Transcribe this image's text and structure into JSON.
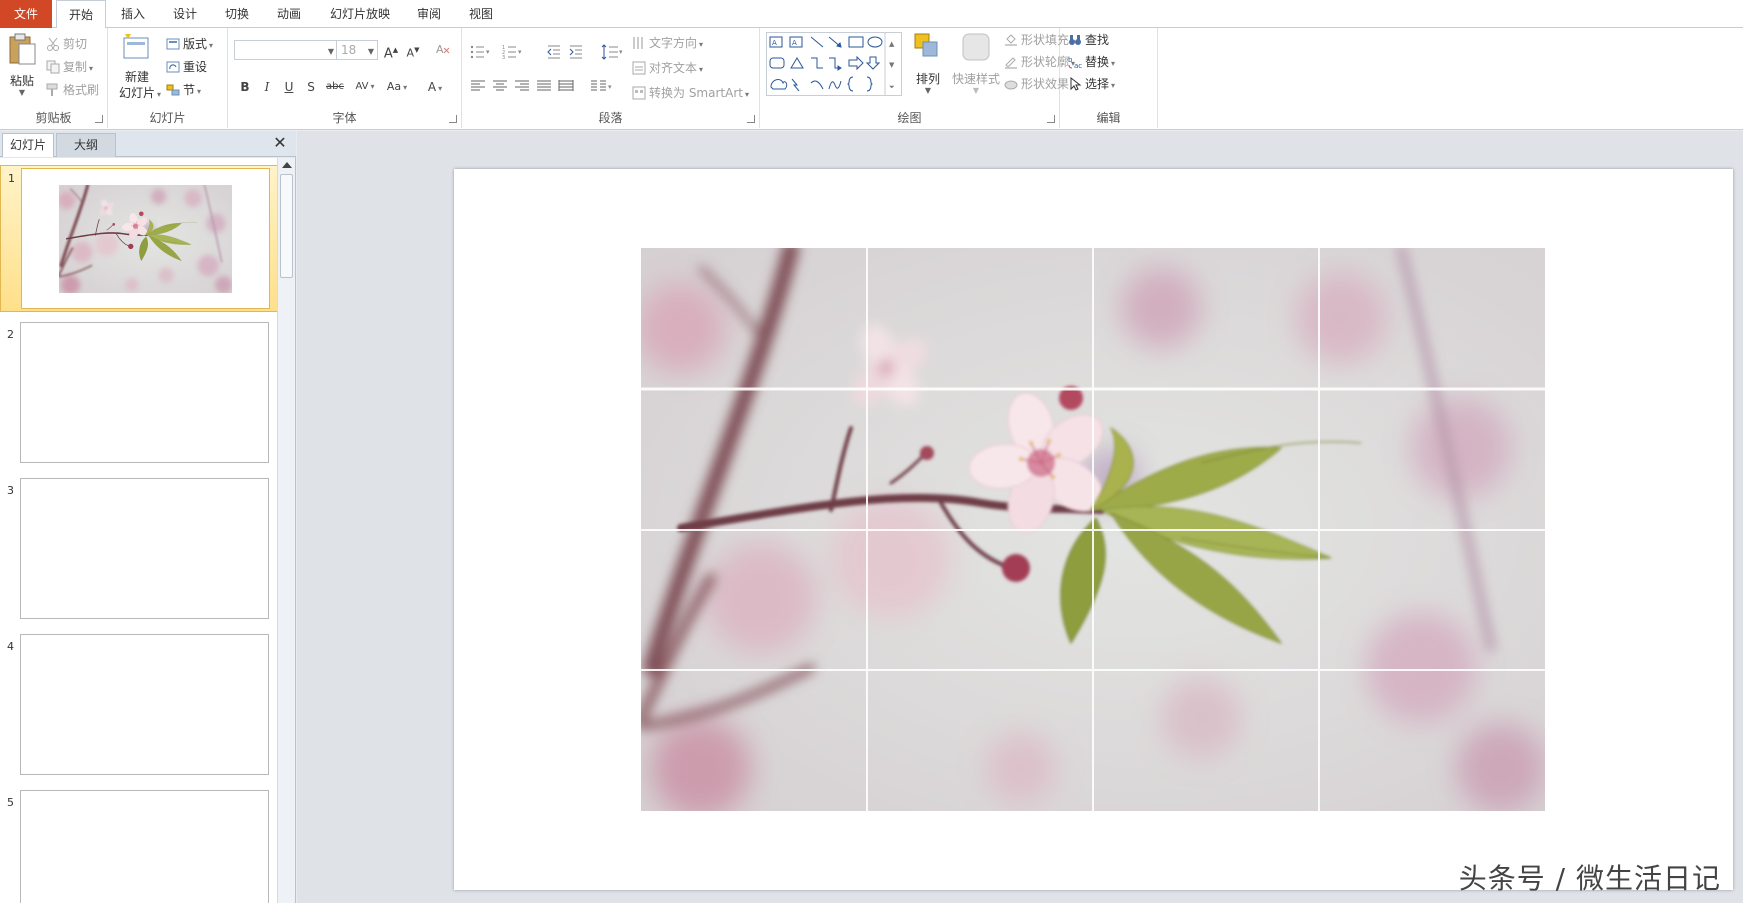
{
  "ribbon_tabs": [
    {
      "label": "文件"
    },
    {
      "label": "开始"
    },
    {
      "label": "插入"
    },
    {
      "label": "设计"
    },
    {
      "label": "切换"
    },
    {
      "label": "动画"
    },
    {
      "label": "幻灯片放映"
    },
    {
      "label": "审阅"
    },
    {
      "label": "视图"
    }
  ],
  "active_tab": "开始",
  "clipboard": {
    "paste": "粘贴",
    "cut": "剪切",
    "copy": "复制",
    "format_painter": "格式刷",
    "label": "剪贴板"
  },
  "slides_group": {
    "new_slide_1": "新建",
    "new_slide_2": "幻灯片",
    "layout": "版式",
    "reset": "重设",
    "section": "节",
    "label": "幻灯片"
  },
  "font": {
    "name_value": "",
    "size_value": "18",
    "label": "字体",
    "bold": "B",
    "italic": "I",
    "underline": "U",
    "shadow": "S",
    "strike": "abc",
    "spacing": "AV",
    "case": "Aa",
    "color": "A"
  },
  "paragraph": {
    "text_direction": "文字方向",
    "align_text": "对齐文本",
    "smartart": "转换为 SmartArt",
    "label": "段落"
  },
  "drawing": {
    "arrange": "排列",
    "quick_styles": "快速样式",
    "shape_fill": "形状填充",
    "shape_outline": "形状轮廓",
    "shape_effects": "形状效果",
    "label": "绘图"
  },
  "editing": {
    "find": "查找",
    "replace": "替换",
    "select": "选择",
    "label": "编辑"
  },
  "panel": {
    "tab_slides": "幻灯片",
    "tab_outline": "大纲",
    "close": "✕"
  },
  "slides": [
    {
      "number": "1",
      "selected": true,
      "has_image": true
    },
    {
      "number": "2",
      "selected": false,
      "has_image": false
    },
    {
      "number": "3",
      "selected": false,
      "has_image": false
    },
    {
      "number": "4",
      "selected": false,
      "has_image": false
    },
    {
      "number": "5",
      "selected": false,
      "has_image": false
    }
  ],
  "watermark": "头条号 / 微生活日记",
  "colors": {
    "file_tab": "#d24726",
    "selection": "#ffe08a",
    "accent": "#2b579a"
  }
}
